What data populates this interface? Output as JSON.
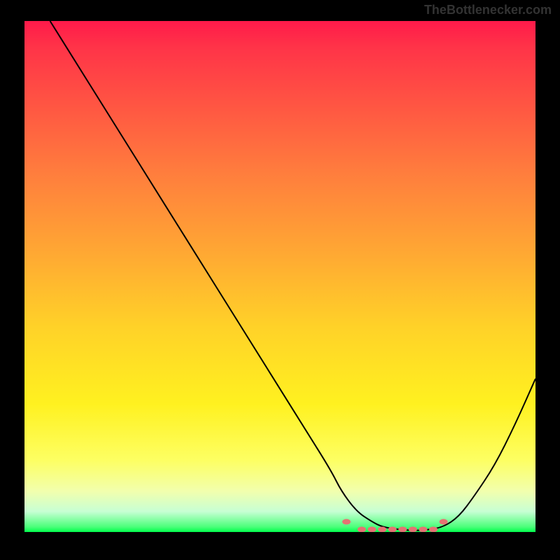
{
  "watermark": "TheBottlenecker.com",
  "chart_data": {
    "type": "line",
    "title": "",
    "xlabel": "",
    "ylabel": "",
    "xlim": [
      0,
      100
    ],
    "ylim": [
      0,
      100
    ],
    "x": [
      5,
      10,
      15,
      20,
      25,
      30,
      35,
      40,
      45,
      50,
      55,
      60,
      62,
      65,
      68,
      70,
      73,
      76,
      79,
      82,
      85,
      88,
      92,
      96,
      100
    ],
    "y": [
      100,
      92,
      84,
      76,
      68,
      60,
      52,
      44,
      36,
      28,
      20,
      12,
      8,
      4,
      2,
      1,
      0.5,
      0.3,
      0.4,
      1,
      3,
      7,
      13,
      21,
      30
    ],
    "marker_region": {
      "x_range": [
        63,
        82
      ],
      "y_value_approx": 0.5,
      "color": "#e57373"
    },
    "background_gradient": {
      "stops": [
        {
          "pos": 0,
          "color": "#ff1a4a"
        },
        {
          "pos": 0.5,
          "color": "#ffc824"
        },
        {
          "pos": 0.9,
          "color": "#fbff5c"
        },
        {
          "pos": 1.0,
          "color": "#00ff4c"
        }
      ]
    }
  }
}
